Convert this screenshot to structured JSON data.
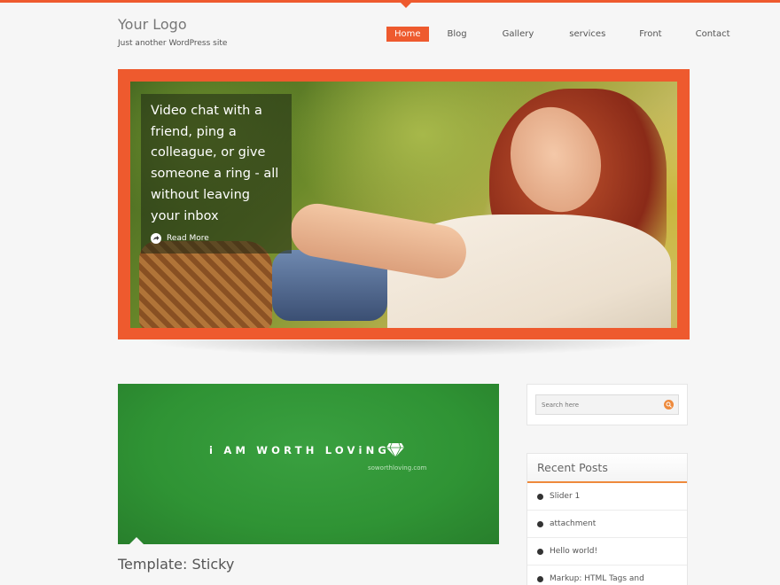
{
  "header": {
    "logo": "Your Logo",
    "tagline": "Just another WordPress site"
  },
  "nav": {
    "items": [
      "Home",
      "Blog",
      "Gallery",
      "services",
      "Front",
      "Contact"
    ],
    "active": "Home"
  },
  "slider": {
    "caption": "Video chat with a friend, ping a colleague, or give someone a ring - all without leaving your inbox",
    "read_more": "Read More"
  },
  "post": {
    "image_title": "i AM WORTH LOViNG",
    "image_subtitle": "soworthloving.com",
    "title": "Template: Sticky"
  },
  "sidebar": {
    "search_placeholder": "Search here",
    "recent_posts_title": "Recent Posts",
    "recent_posts": [
      "Slider 1",
      "attachment",
      "Hello world!",
      "Markup: HTML Tags and"
    ]
  },
  "colors": {
    "accent": "#ee5a2e",
    "secondary_accent": "#ee8a3c",
    "post_green": "#2f9334"
  },
  "icons": {
    "read_more": "arrow-circle-icon",
    "search": "search-icon",
    "diamond": "diamond-icon",
    "bullet": "bullet-icon"
  }
}
